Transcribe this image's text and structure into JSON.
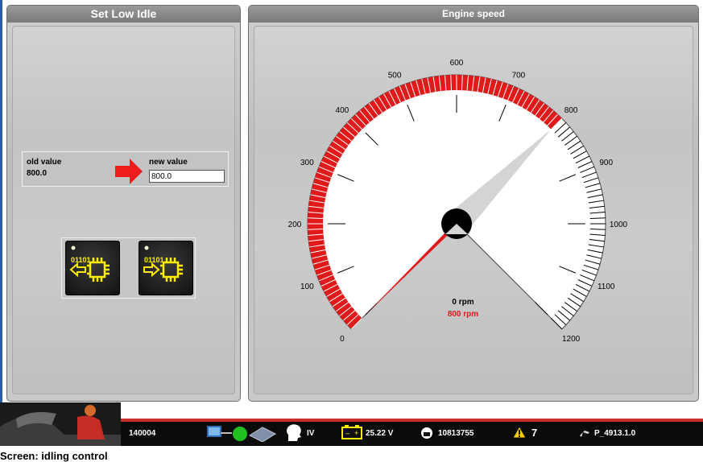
{
  "left_panel": {
    "title": "Set Low Idle",
    "old_value_label": "old value",
    "old_value": "800.0",
    "new_value_label": "new value",
    "new_value": "800.0"
  },
  "right_panel": {
    "title": "Engine speed",
    "gauge": {
      "min": 0,
      "max": 1200,
      "major_ticks": [
        "0",
        "100",
        "200",
        "300",
        "400",
        "500",
        "600",
        "700",
        "800",
        "900",
        "1000",
        "1100",
        "1200"
      ],
      "red_zone": [
        0,
        800
      ],
      "current_value": 0,
      "current_label": "0 rpm",
      "setpoint_value": 800,
      "setpoint_label": "800 rpm",
      "colors": {
        "red": "#e0191b",
        "needle_grey": "#d4d4d4",
        "dial": "#ffffff"
      }
    }
  },
  "statusbar": {
    "id_text": "140004",
    "roman": "IV",
    "voltage": "25.22 V",
    "counter": "10813755",
    "warnings": "7",
    "version": "P_4913.1.0"
  },
  "caption": "Screen: idling control"
}
